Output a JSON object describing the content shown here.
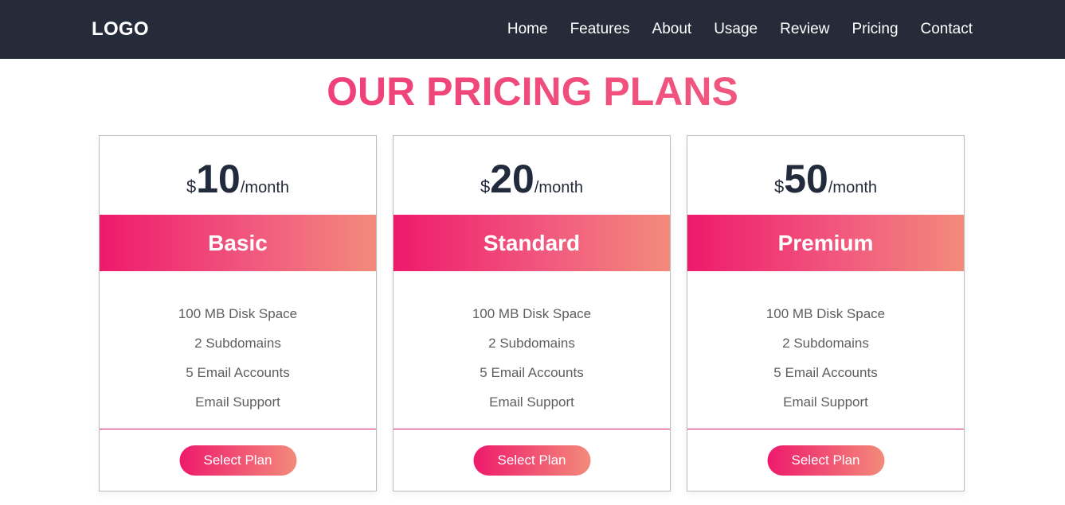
{
  "header": {
    "logo": "LOGO",
    "nav": [
      "Home",
      "Features",
      "About",
      "Usage",
      "Review",
      "Pricing",
      "Contact"
    ]
  },
  "main": {
    "title": "OUR PRICING PLANS",
    "plans": [
      {
        "currency": "$",
        "amount": "10",
        "period": "/month",
        "name": "Basic",
        "features": [
          "100 MB Disk Space",
          "2 Subdomains",
          "5 Email Accounts",
          "Email Support"
        ],
        "button_label": "Select Plan"
      },
      {
        "currency": "$",
        "amount": "20",
        "period": "/month",
        "name": "Standard",
        "features": [
          "100 MB Disk Space",
          "2 Subdomains",
          "5 Email Accounts",
          "Email Support"
        ],
        "button_label": "Select Plan"
      },
      {
        "currency": "$",
        "amount": "50",
        "period": "/month",
        "name": "Premium",
        "features": [
          "100 MB Disk Space",
          "2 Subdomains",
          "5 Email Accounts",
          "Email Support"
        ],
        "button_label": "Select Plan"
      }
    ]
  },
  "colors": {
    "navbar_bg": "#262b3a",
    "accent_start": "#ee1a6c",
    "accent_end": "#f38a7b",
    "price_text": "#222b3b",
    "feature_text": "#5e5e5e"
  }
}
